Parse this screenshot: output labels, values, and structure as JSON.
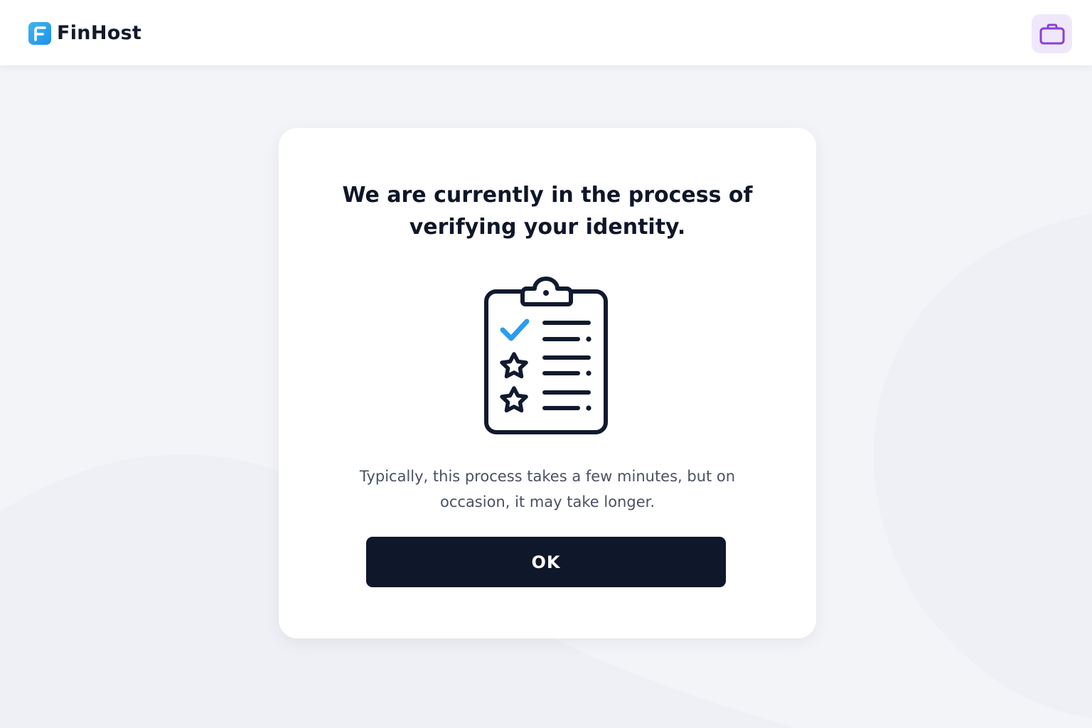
{
  "header": {
    "brand_name": "FinHost",
    "logo_icon": "finhost-logo-icon",
    "wallet_icon": "wallet-icon"
  },
  "dialog": {
    "title": "We are currently in the process of verifying your identity.",
    "illustration_icon": "clipboard-checklist-icon",
    "message": "Typically, this process takes a few minutes, but on occasion, it may take longer.",
    "ok_label": "OK"
  },
  "colors": {
    "primary_dark": "#0f172a",
    "accent_blue": "#2a9ded",
    "accent_purple": "#8a3fd8",
    "wallet_bg": "#efe8fb"
  }
}
